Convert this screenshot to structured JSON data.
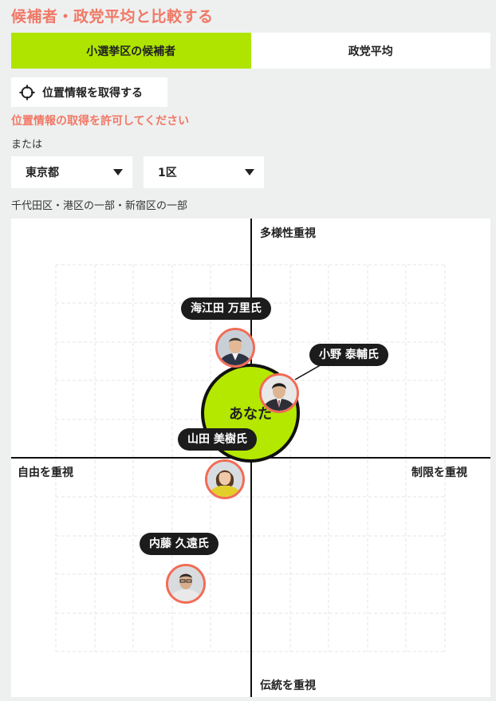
{
  "title": "候補者・政党平均と比較する",
  "tabs": [
    {
      "label": "小選挙区の候補者",
      "active": true
    },
    {
      "label": "政党平均",
      "active": false
    }
  ],
  "location": {
    "button_label": "位置情報を取得する",
    "error_message": "位置情報の取得を許可してください",
    "or_label": "または"
  },
  "selects": {
    "prefecture": "東京都",
    "district": "1区"
  },
  "area_text": "千代田区・港区の一部・新宿区の一部",
  "chart": {
    "axis_top": "多様性重視",
    "axis_bottom": "伝統を重視",
    "axis_left": "自由を重視",
    "axis_right": "制限を重視",
    "you_label": "あなた",
    "candidates": [
      {
        "name": "海江田 万里氏"
      },
      {
        "name": "小野 泰輔氏"
      },
      {
        "name": "山田 美樹氏"
      },
      {
        "name": "内藤 久遠氏"
      }
    ]
  },
  "colors": {
    "accent": "#f07865",
    "active_tab": "#aee400",
    "you": "#b4e800",
    "avatar_ring": "#f26b55",
    "name_tag": "#1c1c1c"
  },
  "icons": {
    "location": "crosshair-icon",
    "dropdown": "triangle-down-icon"
  }
}
